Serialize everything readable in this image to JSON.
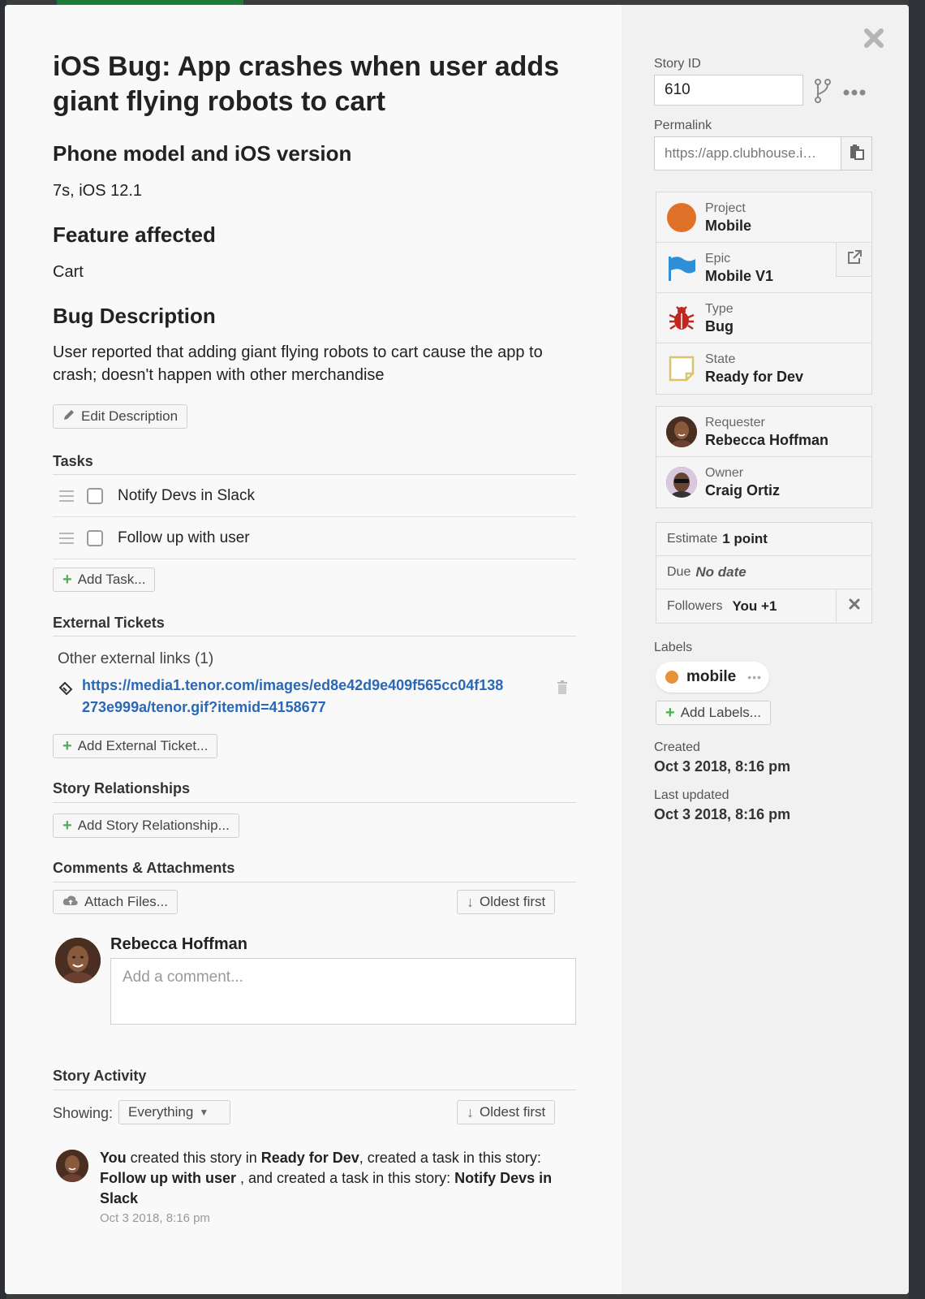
{
  "story": {
    "title": "iOS Bug: App crashes when user adds giant flying robots to cart",
    "sections": [
      {
        "heading": "Phone model and iOS version",
        "body": "7s, iOS 12.1"
      },
      {
        "heading": "Feature affected",
        "body": "Cart"
      },
      {
        "heading": "Bug Description",
        "body": "User reported that adding giant flying robots to cart cause the app to crash; doesn't happen with other merchandise"
      }
    ],
    "edit_description_label": "Edit Description"
  },
  "tasks": {
    "title": "Tasks",
    "items": [
      {
        "label": "Notify Devs in Slack",
        "done": false
      },
      {
        "label": "Follow up with user",
        "done": false
      }
    ],
    "add_label": "Add Task..."
  },
  "external": {
    "title": "External Tickets",
    "other_links_label": "Other external links (1)",
    "link_line1": "https://media1.tenor.com/images/ed8e42d9e409f565cc04f138",
    "link_line2": "273e999a/tenor.gif?itemid=4158677",
    "add_label": "Add External Ticket..."
  },
  "relationships": {
    "title": "Story Relationships",
    "add_label": "Add Story Relationship..."
  },
  "comments": {
    "title": "Comments & Attachments",
    "attach_label": "Attach Files...",
    "sort_label": "Oldest first",
    "author": "Rebecca Hoffman",
    "placeholder": "Add a comment..."
  },
  "activity": {
    "title": "Story Activity",
    "showing_label": "Showing:",
    "filter_value": "Everything",
    "sort_label": "Oldest first",
    "entry": {
      "actor": "You",
      "t1": " created this story in ",
      "state": "Ready for Dev",
      "t2": ", created a task in this story: ",
      "task1": "Follow up with user",
      "t3": " , and created a task in this story: ",
      "task2": "Notify Devs in Slack",
      "time": "Oct 3 2018, 8:16 pm"
    }
  },
  "sidebar": {
    "story_id_label": "Story ID",
    "story_id": "610",
    "permalink_label": "Permalink",
    "permalink": "https://app.clubhouse.i…",
    "project_label": "Project",
    "project": "Mobile",
    "epic_label": "Epic",
    "epic": "Mobile V1",
    "type_label": "Type",
    "type": "Bug",
    "state_label": "State",
    "state": "Ready for Dev",
    "requester_label": "Requester",
    "requester": "Rebecca Hoffman",
    "owner_label": "Owner",
    "owner": "Craig Ortiz",
    "estimate_label": "Estimate",
    "estimate": "1 point",
    "due_label": "Due",
    "due": "No date",
    "followers_label": "Followers",
    "followers": "You +1",
    "labels_label": "Labels",
    "label_chip": "mobile",
    "add_labels": "Add Labels...",
    "created_label": "Created",
    "created": "Oct 3 2018, 8:16 pm",
    "updated_label": "Last updated",
    "updated": "Oct 3 2018, 8:16 pm"
  },
  "colors": {
    "project": "#e07128",
    "epic": "#2f8fd6",
    "bug": "#c0261d",
    "state": "#d8c46c",
    "link": "#2a68b5",
    "plus": "#4caf50",
    "label_dot": "#e8923a"
  },
  "icons": [
    "close-icon",
    "branch-icon",
    "more-icon",
    "clipboard-icon",
    "external-link-icon",
    "pencil-icon",
    "plus-icon",
    "ticket-icon",
    "trash-icon",
    "cloud-upload-icon",
    "arrow-down-icon",
    "caret-down-icon",
    "remove-follower-icon"
  ]
}
